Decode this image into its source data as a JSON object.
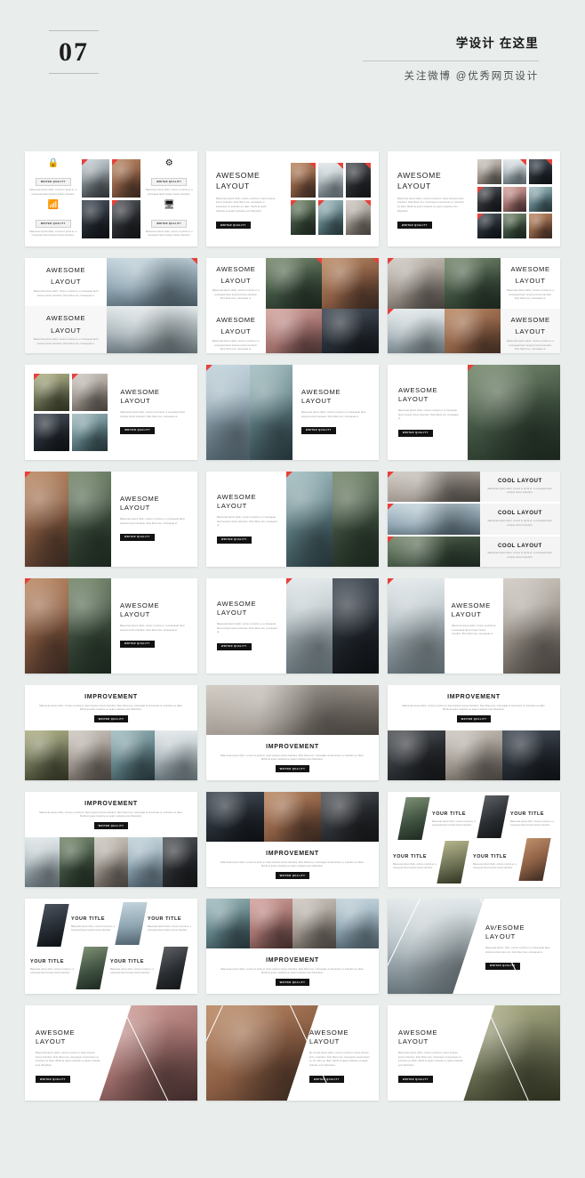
{
  "header": {
    "number": "07",
    "title_cn": "学设计 在这里",
    "subtitle_cn": "关注微博 @优秀网页设计"
  },
  "labels": {
    "awesome_layout_l1": "AWESOME",
    "awesome_layout_l2": "LAYOUT",
    "cool_layout": "COOL LAYOUT",
    "improvement": "IMPROVEMENT",
    "your_title": "YOUR TITLE",
    "writer_quality": "WRITER QUALITY",
    "body_text": "Maecenas ipsum dolor, cursus ut porta et, fauci tempus luctus interdum. Duis libero leo, consequat ut accumsan ut, interdum eu diam. Morbi at quam molestie eu quam molestie eros bibendum.",
    "body_text_short": "Maecenas ipsum dolor, cursus ut porta et, a consequat fauci tempus luctus interdum. Duis libero leo, consequat ut.",
    "body_text_tiny": "Maecenas ipsum dolor, cursus ut porta et, a consequat fauci tempus luctus interdum."
  },
  "colors": {
    "page_background": "#e9edec",
    "slide_background": "#ffffff",
    "accent_red": "#e8403a",
    "badge_black": "#121212",
    "text_dark": "#1a1a1a",
    "text_muted": "#8d8f90"
  },
  "slides": [
    {
      "id": 1,
      "layout": "icon-feature-grid",
      "title": "",
      "icons": [
        "lock-icon",
        "gear-icon",
        "wifi-icon",
        "monitor-icon"
      ]
    },
    {
      "id": 2,
      "layout": "text-left-gallery-2x3",
      "title": "AWESOME LAYOUT"
    },
    {
      "id": 3,
      "layout": "text-left-gallery-3x3",
      "title": "AWESOME LAYOUT"
    },
    {
      "id": 4,
      "layout": "split-stacked-text-photo",
      "title": "AWESOME LAYOUT"
    },
    {
      "id": 5,
      "layout": "split-stacked-text-duo",
      "title": "AWESOME LAYOUT"
    },
    {
      "id": 6,
      "layout": "split-stacked-duo-text",
      "title": "AWESOME LAYOUT"
    },
    {
      "id": 7,
      "layout": "mosaic-left-text-right",
      "title": "AWESOME LAYOUT"
    },
    {
      "id": 8,
      "layout": "photos-left-text-right",
      "title": "AWESOME LAYOUT"
    },
    {
      "id": 9,
      "layout": "text-left-photo-right",
      "title": "AWESOME LAYOUT"
    },
    {
      "id": 10,
      "layout": "photos-left-text-right",
      "title": "AWESOME LAYOUT"
    },
    {
      "id": 11,
      "layout": "text-left-gallery-2x2",
      "title": "AWESOME LAYOUT"
    },
    {
      "id": 12,
      "layout": "cool-layout-rows",
      "title": "COOL LAYOUT"
    },
    {
      "id": 13,
      "layout": "photos-left-text-right",
      "title": "AWESOME LAYOUT"
    },
    {
      "id": 14,
      "layout": "text-left-gallery-2x2",
      "title": "AWESOME LAYOUT"
    },
    {
      "id": 15,
      "layout": "photos-text-photo",
      "title": "AWESOME LAYOUT"
    },
    {
      "id": 16,
      "layout": "improvement-top",
      "title": "IMPROVEMENT"
    },
    {
      "id": 17,
      "layout": "improvement-bottom",
      "title": "IMPROVEMENT"
    },
    {
      "id": 18,
      "layout": "improvement-top",
      "title": "IMPROVEMENT"
    },
    {
      "id": 19,
      "layout": "improvement-top",
      "title": "IMPROVEMENT"
    },
    {
      "id": 20,
      "layout": "improvement-bottom",
      "title": "IMPROVEMENT"
    },
    {
      "id": 21,
      "layout": "your-title-skewed",
      "title": "YOUR TITLE"
    },
    {
      "id": 22,
      "layout": "your-title-skewed",
      "title": "YOUR TITLE"
    },
    {
      "id": 23,
      "layout": "improvement-bottom",
      "title": "IMPROVEMENT"
    },
    {
      "id": 24,
      "layout": "triangle-text-right",
      "title": "AWESOME LAYOUT"
    },
    {
      "id": 25,
      "layout": "triangle-text-left",
      "title": "AWESOME LAYOUT"
    },
    {
      "id": 26,
      "layout": "triangle-center",
      "title": "AWESOME LAYOUT"
    },
    {
      "id": 27,
      "layout": "triangle-text-left",
      "title": "AWESOME LAYOUT"
    }
  ]
}
